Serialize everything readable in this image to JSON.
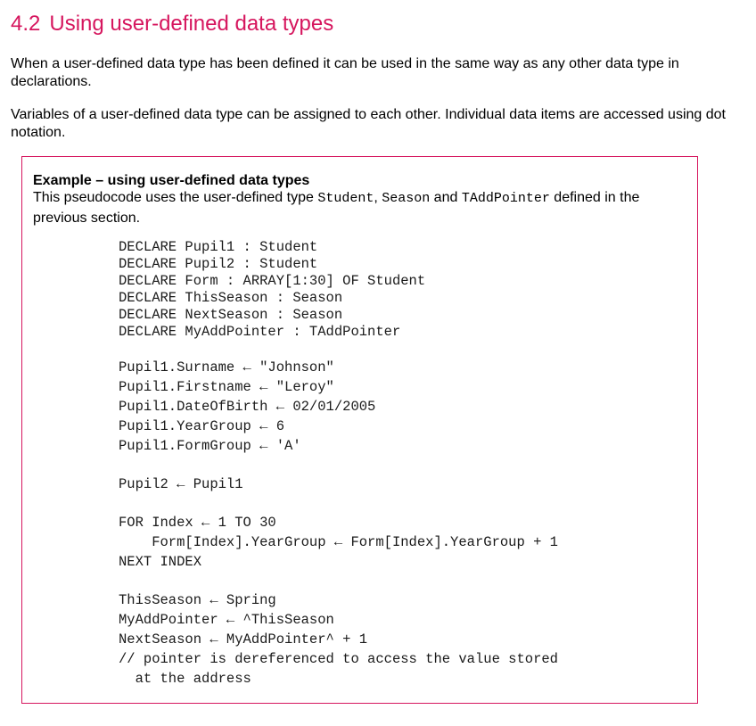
{
  "section": {
    "number": "4.2",
    "title": "Using user-defined data types"
  },
  "paragraphs": [
    "When a user-defined data type has been defined it can be used in the same way as any other data type in declarations.",
    "Variables of a user-defined data type can be assigned to each other. Individual data items are accessed using dot notation."
  ],
  "example": {
    "title": "Example – using user-defined data types",
    "intro_prefix": "This pseudocode uses the user-defined type ",
    "type_1": "Student",
    "sep_1": ", ",
    "type_2": "Season",
    "sep_2": " and ",
    "type_3": "TAddPointer",
    "intro_suffix": " defined in the previous section.",
    "code_groups": [
      [
        "DECLARE Pupil1 : Student",
        "DECLARE Pupil2 : Student",
        "DECLARE Form : ARRAY[1:30] OF Student",
        "DECLARE ThisSeason : Season",
        "DECLARE NextSeason : Season",
        "DECLARE MyAddPointer : TAddPointer"
      ],
      [
        "Pupil1.Surname ← \"Johnson\"",
        "Pupil1.Firstname ← \"Leroy\"",
        "Pupil1.DateOfBirth ← 02/01/2005",
        "Pupil1.YearGroup ← 6",
        "Pupil1.FormGroup ← 'A'"
      ],
      [
        "Pupil2 ← Pupil1"
      ],
      [
        "FOR Index ← 1 TO 30",
        "    Form[Index].YearGroup ← Form[Index].YearGroup + 1",
        "NEXT INDEX"
      ],
      [
        "ThisSeason ← Spring",
        "MyAddPointer ← ^ThisSeason",
        "NextSeason ← MyAddPointer^ + 1",
        "// pointer is dereferenced to access the value stored",
        "  at the address"
      ]
    ]
  },
  "colors": {
    "accent": "#d6165e"
  }
}
